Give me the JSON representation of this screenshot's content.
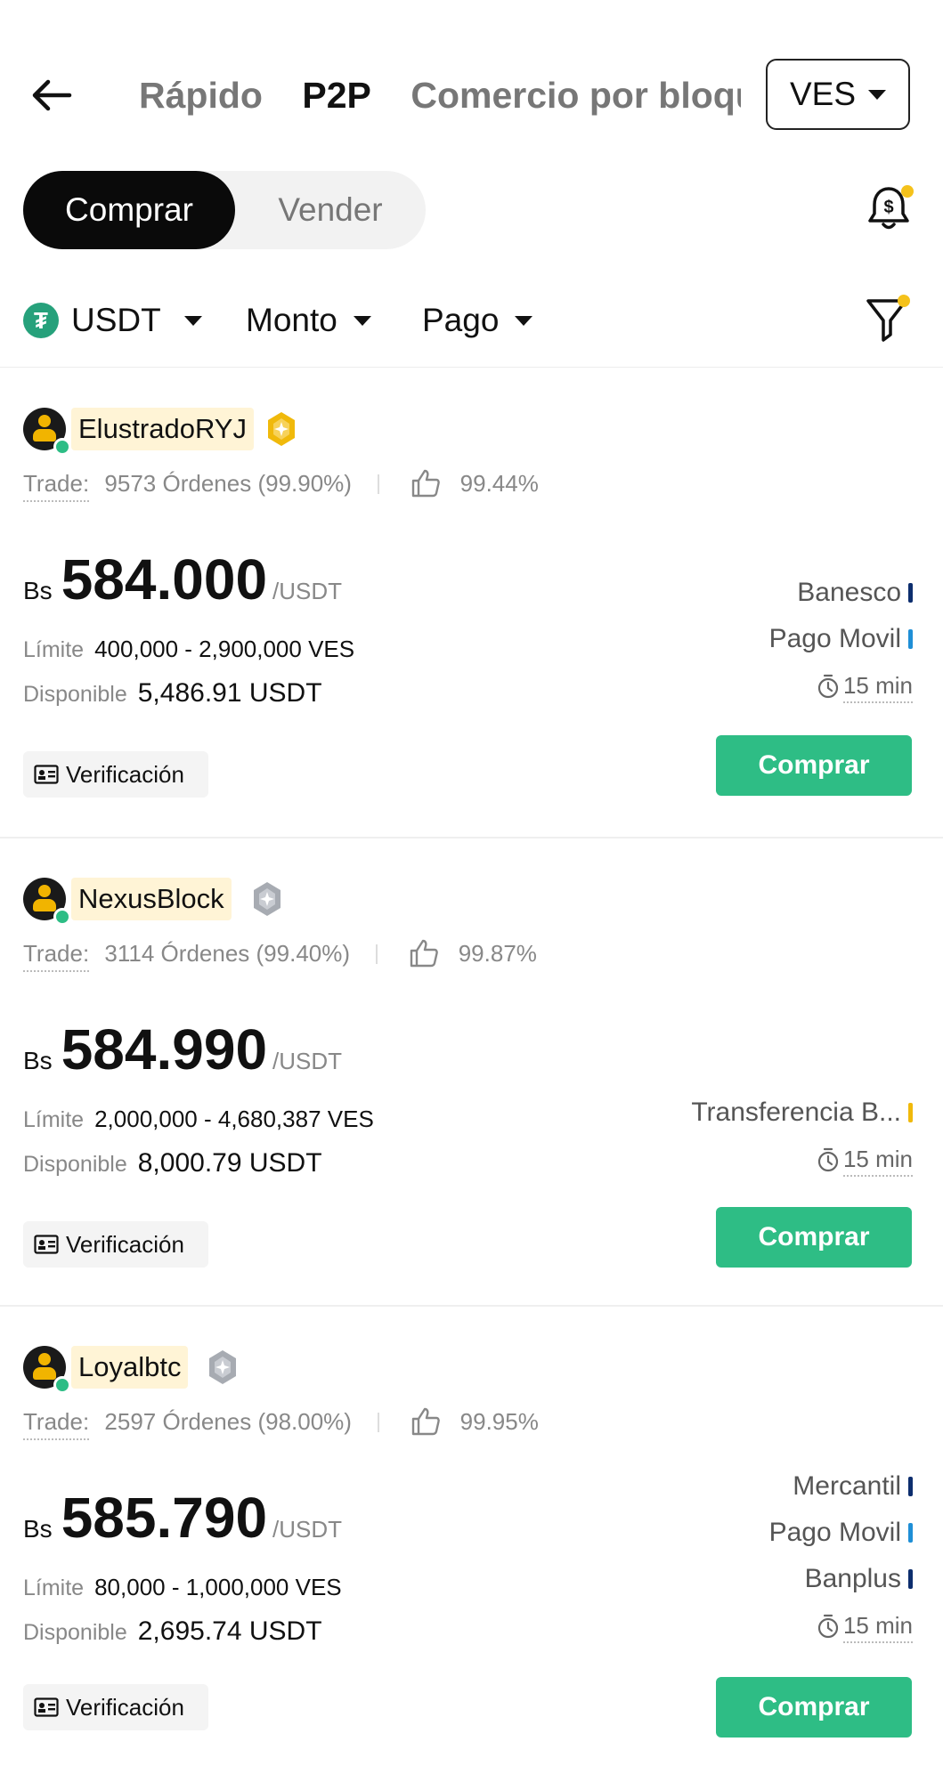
{
  "header": {
    "tabs": [
      {
        "label": "Rápido",
        "active": false
      },
      {
        "label": "P2P",
        "active": true
      },
      {
        "label": "Comercio por bloques",
        "active": false
      }
    ],
    "fiat": "VES"
  },
  "side_toggle": {
    "buy": "Comprar",
    "sell": "Vender",
    "selected": "buy"
  },
  "filters": {
    "asset": "USDT",
    "amount": "Monto",
    "payment": "Pago"
  },
  "colors": {
    "accent": "#2ebd85",
    "badge_dot": "#f5c21b",
    "tether": "#26a17b"
  },
  "offers": [
    {
      "merchant": "ElustradoRYJ",
      "badge": "gold-badge-icon",
      "trade_label": "Trade:",
      "orders": "9573 Órdenes",
      "completion": "(99.90%)",
      "positive": "99.44%",
      "currency": "Bs",
      "price": "584.000",
      "unit": "/USDT",
      "limit_label": "Límite",
      "limit": "400,000 - 2,900,000 VES",
      "available_label": "Disponible",
      "available": "5,486.91 USDT",
      "verification": "Verificación",
      "payments": [
        {
          "name": "Banesco",
          "color": "#0d2e6e"
        },
        {
          "name": "Pago Movil",
          "color": "#1f8fd6"
        }
      ],
      "time": "15 min",
      "action": "Comprar"
    },
    {
      "merchant": "NexusBlock",
      "badge": "silver-badge-icon",
      "trade_label": "Trade:",
      "orders": "3114 Órdenes",
      "completion": "(99.40%)",
      "positive": "99.87%",
      "currency": "Bs",
      "price": "584.990",
      "unit": "/USDT",
      "limit_label": "Límite",
      "limit": "2,000,000 - 4,680,387 VES",
      "available_label": "Disponible",
      "available": "8,000.79 USDT",
      "verification": "Verificación",
      "payments": [
        {
          "name": "Transferencia B...",
          "color": "#f0b90b"
        }
      ],
      "time": "15 min",
      "action": "Comprar"
    },
    {
      "merchant": "Loyalbtc",
      "badge": "silver-badge-icon",
      "trade_label": "Trade:",
      "orders": "2597 Órdenes",
      "completion": "(98.00%)",
      "positive": "99.95%",
      "currency": "Bs",
      "price": "585.790",
      "unit": "/USDT",
      "limit_label": "Límite",
      "limit": "80,000 - 1,000,000 VES",
      "available_label": "Disponible",
      "available": "2,695.74 USDT",
      "verification": "Verificación",
      "payments": [
        {
          "name": "Mercantil",
          "color": "#0d2e6e"
        },
        {
          "name": "Pago Movil",
          "color": "#1f8fd6"
        },
        {
          "name": "Banplus",
          "color": "#0d2e6e"
        }
      ],
      "time": "15 min",
      "action": "Comprar"
    }
  ]
}
